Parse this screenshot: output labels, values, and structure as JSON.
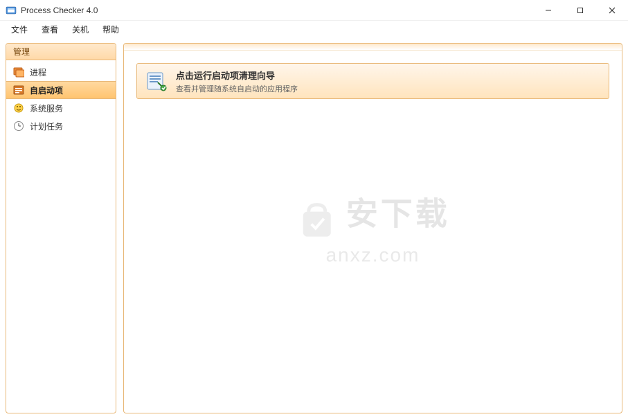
{
  "window": {
    "title": "Process Checker 4.0"
  },
  "menu": {
    "file": "文件",
    "view": "查看",
    "shutdown": "关机",
    "help": "帮助"
  },
  "sidebar": {
    "header": "管理",
    "items": [
      {
        "label": "进程"
      },
      {
        "label": "自启动项"
      },
      {
        "label": "系统服务"
      },
      {
        "label": "计划任务"
      }
    ],
    "active_index": 1
  },
  "wizard": {
    "title": "点击运行启动项清理向导",
    "subtitle": "查看并管理随系统自启动的应用程序"
  },
  "watermark": {
    "line1": "安下载",
    "line2": "anxz.com"
  }
}
